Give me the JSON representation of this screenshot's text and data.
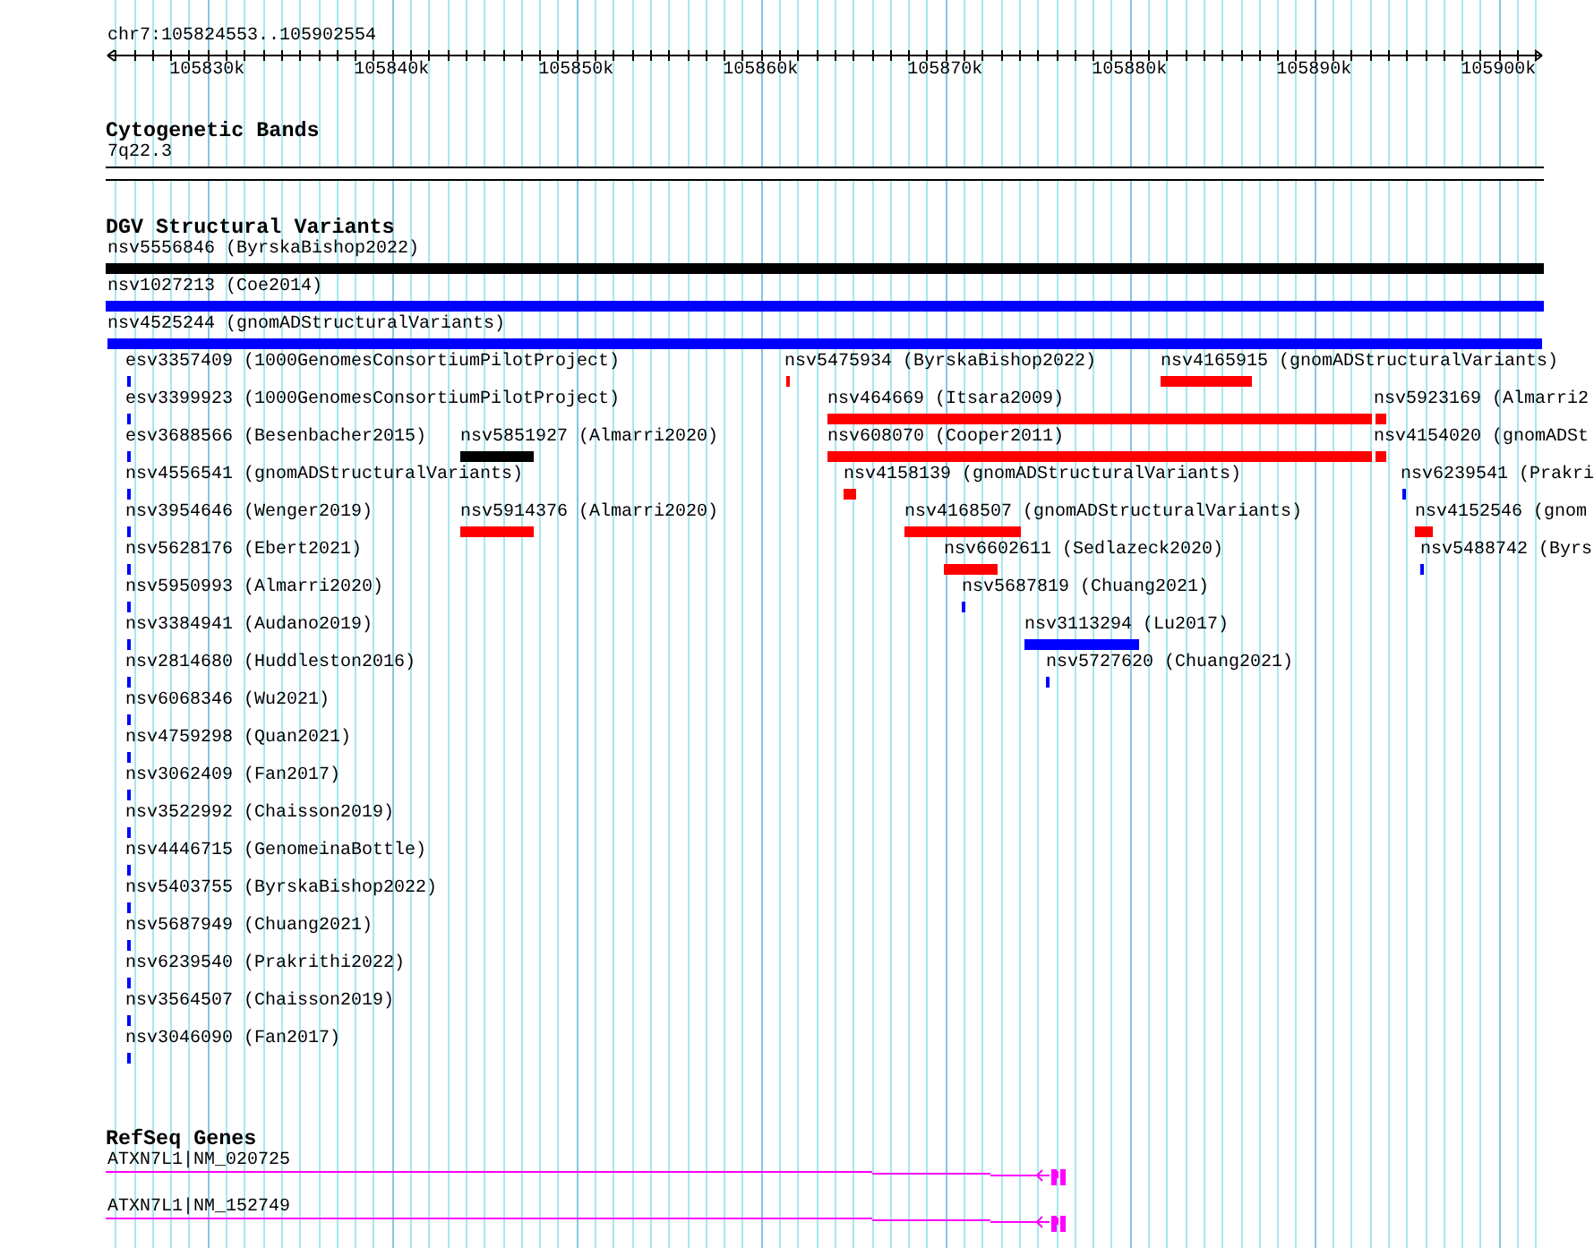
{
  "location": "chr7:105824553..105902554",
  "ruler": {
    "ticks": [
      "105830k",
      "105840k",
      "105850k",
      "105860k",
      "105870k",
      "105880k",
      "105890k",
      "105900k"
    ]
  },
  "tracks": [
    {
      "kind": "cytoband",
      "title": "Cytogenetic Bands",
      "band": "7q22.3"
    },
    {
      "kind": "variants",
      "title": "DGV Structural Variants",
      "features": [
        {
          "label": "nsv5556846 (ByrskaBishop2022)",
          "color": "#000000"
        },
        {
          "label": "nsv1027213 (Coe2014)",
          "color": "#0000ff"
        },
        {
          "label": "nsv4525244 (gnomADStructuralVariants)",
          "color": "#0000ff"
        },
        {
          "label": "esv3357409 (1000GenomesConsortiumPilotProject)",
          "color": "#0000ff"
        },
        {
          "label": "nsv5475934 (ByrskaBishop2022)",
          "color": "#ff0000"
        },
        {
          "label": "nsv4165915 (gnomADStructuralVariants)",
          "color": "#ff0000"
        },
        {
          "label": "esv3399923 (1000GenomesConsortiumPilotProject)",
          "color": "#0000ff"
        },
        {
          "label": "nsv464669 (Itsara2009)",
          "color": "#ff0000"
        },
        {
          "label": "nsv5923169 (Almarri2",
          "color": "#ff0000"
        },
        {
          "label": "esv3688566 (Besenbacher2015)",
          "color": "#0000ff"
        },
        {
          "label": "nsv5851927 (Almarri2020)",
          "color": "#000000"
        },
        {
          "label": "nsv608070 (Cooper2011)",
          "color": "#ff0000"
        },
        {
          "label": "nsv4154020 (gnomADSt",
          "color": "#ff0000"
        },
        {
          "label": "nsv4556541 (gnomADStructuralVariants)",
          "color": "#0000ff"
        },
        {
          "label": "nsv4158139 (gnomADStructuralVariants)",
          "color": "#ff0000"
        },
        {
          "label": "nsv6239541 (Prakri",
          "color": "#0000ff"
        },
        {
          "label": "nsv3954646 (Wenger2019)",
          "color": "#0000ff"
        },
        {
          "label": "nsv5914376 (Almarri2020)",
          "color": "#ff0000"
        },
        {
          "label": "nsv4168507 (gnomADStructuralVariants)",
          "color": "#ff0000"
        },
        {
          "label": "nsv4152546 (gnom",
          "color": "#ff0000"
        },
        {
          "label": "nsv5628176 (Ebert2021)",
          "color": "#0000ff"
        },
        {
          "label": "nsv6602611 (Sedlazeck2020)",
          "color": "#ff0000"
        },
        {
          "label": "nsv5488742 (Byrs",
          "color": "#0000ff"
        },
        {
          "label": "nsv5950993 (Almarri2020)",
          "color": "#0000ff"
        },
        {
          "label": "nsv5687819 (Chuang2021)",
          "color": "#0000ff"
        },
        {
          "label": "nsv3384941 (Audano2019)",
          "color": "#0000ff"
        },
        {
          "label": "nsv3113294 (Lu2017)",
          "color": "#0000ff"
        },
        {
          "label": "nsv2814680 (Huddleston2016)",
          "color": "#0000ff"
        },
        {
          "label": "nsv5727620 (Chuang2021)",
          "color": "#0000ff"
        },
        {
          "label": "nsv6068346 (Wu2021)",
          "color": "#0000ff"
        },
        {
          "label": "nsv4759298 (Quan2021)",
          "color": "#0000ff"
        },
        {
          "label": "nsv3062409 (Fan2017)",
          "color": "#0000ff"
        },
        {
          "label": "nsv3522992 (Chaisson2019)",
          "color": "#0000ff"
        },
        {
          "label": "nsv4446715 (GenomeinaBottle)",
          "color": "#0000ff"
        },
        {
          "label": "nsv5403755 (ByrskaBishop2022)",
          "color": "#0000ff"
        },
        {
          "label": "nsv5687949 (Chuang2021)",
          "color": "#0000ff"
        },
        {
          "label": "nsv6239540 (Prakrithi2022)",
          "color": "#0000ff"
        },
        {
          "label": "nsv3564507 (Chaisson2019)",
          "color": "#0000ff"
        },
        {
          "label": "nsv3046090 (Fan2017)",
          "color": "#0000ff"
        }
      ]
    },
    {
      "kind": "genes",
      "title": "RefSeq Genes",
      "transcripts": [
        {
          "label": "ATXN7L1|NM_020725"
        },
        {
          "label": "ATXN7L1|NM_152749"
        }
      ]
    }
  ]
}
